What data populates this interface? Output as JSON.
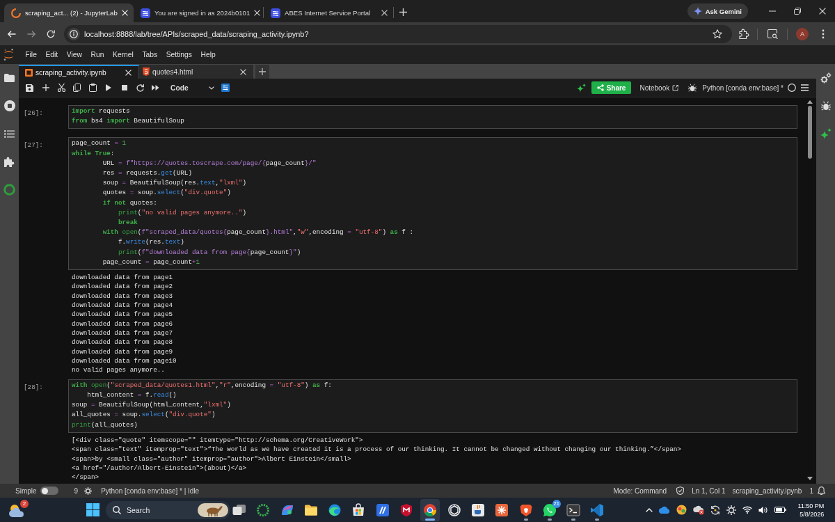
{
  "browser": {
    "tabs": [
      {
        "title": "scraping_act... (2) - JupyterLab",
        "kind": "loading",
        "selected": true
      },
      {
        "title": "You are signed in as 2024b0101",
        "kind": "portal",
        "selected": false
      },
      {
        "title": "ABES Internet Service Portal",
        "kind": "portal",
        "selected": false
      }
    ],
    "gemini_button": "Ask Gemini",
    "back": {
      "disabled": false
    },
    "forward": {
      "disabled": true
    },
    "url": "localhost:8888/lab/tree/APIs/scraped_data/scraping_activity.ipynb?",
    "avatar": "A"
  },
  "menu": [
    "File",
    "Edit",
    "View",
    "Run",
    "Kernel",
    "Tabs",
    "Settings",
    "Help"
  ],
  "doc_tabs": [
    {
      "title": "scraping_activity.ipynb",
      "kind": "notebook",
      "selected": true
    },
    {
      "title": "quotes4.html",
      "kind": "html",
      "selected": false
    }
  ],
  "toolbar": {
    "cell_type": "Code",
    "share": "Share",
    "notebook": "Notebook",
    "kernel": "Python [conda env:base] *"
  },
  "cells": [
    {
      "prompt": "[26]:",
      "lines": [
        [
          {
            "kind": "kw",
            "text": "import"
          },
          {
            "kind": "plain",
            "text": " requests"
          }
        ],
        [
          {
            "kind": "kw",
            "text": "from"
          },
          {
            "kind": "plain",
            "text": " bs4 "
          },
          {
            "kind": "kw",
            "text": "import"
          },
          {
            "kind": "plain",
            "text": " BeautifulSoup"
          }
        ]
      ]
    },
    {
      "prompt": "[27]:",
      "lines": [
        [
          {
            "kind": "plain",
            "text": "page_count "
          },
          {
            "kind": "op",
            "text": "="
          },
          {
            "kind": "num",
            "text": " 1"
          }
        ],
        [
          {
            "kind": "kw",
            "text": "while"
          },
          {
            "kind": "kw",
            "text": " True"
          },
          {
            "kind": "plain",
            "text": ":"
          }
        ],
        [
          {
            "kind": "plain",
            "text": "        URL "
          },
          {
            "kind": "op",
            "text": "="
          },
          {
            "kind": "fstr",
            "text": " f\"https://quotes.toscrape.com/page/{"
          },
          {
            "kind": "plain",
            "text": "page_count"
          },
          {
            "kind": "fstr",
            "text": "}/\""
          }
        ],
        [
          {
            "kind": "plain",
            "text": "        res "
          },
          {
            "kind": "op",
            "text": "="
          },
          {
            "kind": "plain",
            "text": " requests."
          },
          {
            "kind": "attr",
            "text": "get"
          },
          {
            "kind": "plain",
            "text": "(URL)"
          }
        ],
        [
          {
            "kind": "plain",
            "text": "        soup "
          },
          {
            "kind": "op",
            "text": "="
          },
          {
            "kind": "plain",
            "text": " BeautifulSoup(res."
          },
          {
            "kind": "attr",
            "text": "text"
          },
          {
            "kind": "plain",
            "text": ","
          },
          {
            "kind": "str",
            "text": "\"lxml\""
          },
          {
            "kind": "plain",
            "text": ")"
          }
        ],
        [
          {
            "kind": "plain",
            "text": "        quotes "
          },
          {
            "kind": "op",
            "text": "="
          },
          {
            "kind": "plain",
            "text": " soup."
          },
          {
            "kind": "attr",
            "text": "select"
          },
          {
            "kind": "plain",
            "text": "("
          },
          {
            "kind": "str",
            "text": "\"div.quote\""
          },
          {
            "kind": "plain",
            "text": ")"
          }
        ],
        [
          {
            "kind": "kw",
            "text": "        if"
          },
          {
            "kind": "kw",
            "text": " not"
          },
          {
            "kind": "plain",
            "text": " quotes:"
          }
        ],
        [
          {
            "kind": "builtin",
            "text": "            print"
          },
          {
            "kind": "plain",
            "text": "("
          },
          {
            "kind": "str",
            "text": "\"no valid pages anymore..\""
          },
          {
            "kind": "plain",
            "text": ")"
          }
        ],
        [
          {
            "kind": "kw",
            "text": "            break"
          }
        ],
        [
          {
            "kind": "kw",
            "text": "        with"
          },
          {
            "kind": "builtin",
            "text": " open"
          },
          {
            "kind": "plain",
            "text": "("
          },
          {
            "kind": "fstr",
            "text": "f\"scraped_data/quotes{"
          },
          {
            "kind": "plain",
            "text": "page_count"
          },
          {
            "kind": "fstr",
            "text": "}.html\""
          },
          {
            "kind": "plain",
            "text": ","
          },
          {
            "kind": "str",
            "text": "\"w\""
          },
          {
            "kind": "plain",
            "text": ",encoding "
          },
          {
            "kind": "op",
            "text": "="
          },
          {
            "kind": "str",
            "text": " \"utf-8\""
          },
          {
            "kind": "plain",
            "text": ") "
          },
          {
            "kind": "kw",
            "text": "as"
          },
          {
            "kind": "plain",
            "text": " f :"
          }
        ],
        [
          {
            "kind": "plain",
            "text": "            f."
          },
          {
            "kind": "attr",
            "text": "write"
          },
          {
            "kind": "plain",
            "text": "(res."
          },
          {
            "kind": "attr",
            "text": "text"
          },
          {
            "kind": "plain",
            "text": ")"
          }
        ],
        [
          {
            "kind": "builtin",
            "text": "            print"
          },
          {
            "kind": "plain",
            "text": "("
          },
          {
            "kind": "fstr",
            "text": "f\"downloaded data from page{"
          },
          {
            "kind": "plain",
            "text": "page_count"
          },
          {
            "kind": "fstr",
            "text": "}\""
          },
          {
            "kind": "plain",
            "text": ")"
          }
        ],
        [
          {
            "kind": "plain",
            "text": "        page_count "
          },
          {
            "kind": "op",
            "text": "="
          },
          {
            "kind": "plain",
            "text": " page_count"
          },
          {
            "kind": "op",
            "text": "+"
          },
          {
            "kind": "num",
            "text": "1"
          }
        ]
      ],
      "output": [
        "downloaded data from page1",
        "downloaded data from page2",
        "downloaded data from page3",
        "downloaded data from page4",
        "downloaded data from page5",
        "downloaded data from page6",
        "downloaded data from page7",
        "downloaded data from page8",
        "downloaded data from page9",
        "downloaded data from page10",
        "no valid pages anymore.."
      ]
    },
    {
      "prompt": "[28]:",
      "lines": [
        [
          {
            "kind": "kw",
            "text": "with"
          },
          {
            "kind": "builtin",
            "text": " open"
          },
          {
            "kind": "plain",
            "text": "("
          },
          {
            "kind": "str",
            "text": "\"scraped_data/quotes1.html\""
          },
          {
            "kind": "plain",
            "text": ","
          },
          {
            "kind": "str",
            "text": "\"r\""
          },
          {
            "kind": "plain",
            "text": ",encoding "
          },
          {
            "kind": "op",
            "text": "="
          },
          {
            "kind": "str",
            "text": " \"utf-8\""
          },
          {
            "kind": "plain",
            "text": ") "
          },
          {
            "kind": "kw",
            "text": "as"
          },
          {
            "kind": "plain",
            "text": " f:"
          }
        ],
        [
          {
            "kind": "plain",
            "text": "    html_content "
          },
          {
            "kind": "op",
            "text": "="
          },
          {
            "kind": "plain",
            "text": " f."
          },
          {
            "kind": "attr",
            "text": "read"
          },
          {
            "kind": "plain",
            "text": "()"
          }
        ],
        [
          {
            "kind": "plain",
            "text": "soup "
          },
          {
            "kind": "op",
            "text": "="
          },
          {
            "kind": "plain",
            "text": " BeautifulSoup(html_content,"
          },
          {
            "kind": "str",
            "text": "\"lxml\""
          },
          {
            "kind": "plain",
            "text": ")"
          }
        ],
        [
          {
            "kind": "plain",
            "text": "all_quotes "
          },
          {
            "kind": "op",
            "text": "="
          },
          {
            "kind": "plain",
            "text": " soup."
          },
          {
            "kind": "attr",
            "text": "select"
          },
          {
            "kind": "plain",
            "text": "("
          },
          {
            "kind": "str",
            "text": "\"div.quote\""
          },
          {
            "kind": "plain",
            "text": ")"
          }
        ],
        [
          {
            "kind": "builtin",
            "text": "print"
          },
          {
            "kind": "plain",
            "text": "(all_quotes)"
          }
        ]
      ],
      "output": [
        "[<div class=\"quote\" itemscope=\"\" itemtype=\"http://schema.org/CreativeWork\">",
        "<span class=\"text\" itemprop=\"text\">“The world as we have created it is a process of our thinking. It cannot be changed without changing our thinking.”</span>",
        "<span>by <small class=\"author\" itemprop=\"author\">Albert Einstein</small>",
        "<a href=\"/author/Albert-Einstein\">(about)</a>",
        "</span>"
      ]
    }
  ],
  "status_bar": {
    "simple_label": "Simple",
    "simple_on": false,
    "kernels": "9",
    "kernel_status": "Python [conda env:base] * | Idle",
    "mode": "Mode: Command",
    "cursor": "Ln 1, Col 1",
    "file": "scraping_activity.ipynb",
    "notifications": "1"
  },
  "taskbar": {
    "weather_badge": "2",
    "search_placeholder": "Search",
    "apps": [
      {
        "kind": "task_view",
        "running": false,
        "selected": false
      },
      {
        "kind": "ring",
        "running": false,
        "selected": false
      },
      {
        "kind": "swirl",
        "running": false,
        "selected": false
      },
      {
        "kind": "folder",
        "running": false,
        "selected": false
      },
      {
        "kind": "wave",
        "running": false,
        "selected": false
      },
      {
        "kind": "bag",
        "running": false,
        "selected": false
      },
      {
        "kind": "slash_tile",
        "running": false,
        "selected": false
      },
      {
        "kind": "shield",
        "running": false,
        "selected": false
      },
      {
        "kind": "tricolor",
        "running": true,
        "selected": true
      },
      {
        "kind": "knot",
        "running": false,
        "selected": false
      },
      {
        "kind": "cup",
        "running": false,
        "selected": false
      },
      {
        "kind": "starburst",
        "running": false,
        "selected": false
      },
      {
        "kind": "lion",
        "running": true,
        "selected": false
      },
      {
        "kind": "chat",
        "badge": "21",
        "running": true,
        "selected": false
      },
      {
        "kind": "terminal",
        "running": true,
        "selected": false
      },
      {
        "kind": "ribbon",
        "running": true,
        "selected": false
      }
    ],
    "time": "11:50 PM",
    "date": "5/8/2026"
  }
}
